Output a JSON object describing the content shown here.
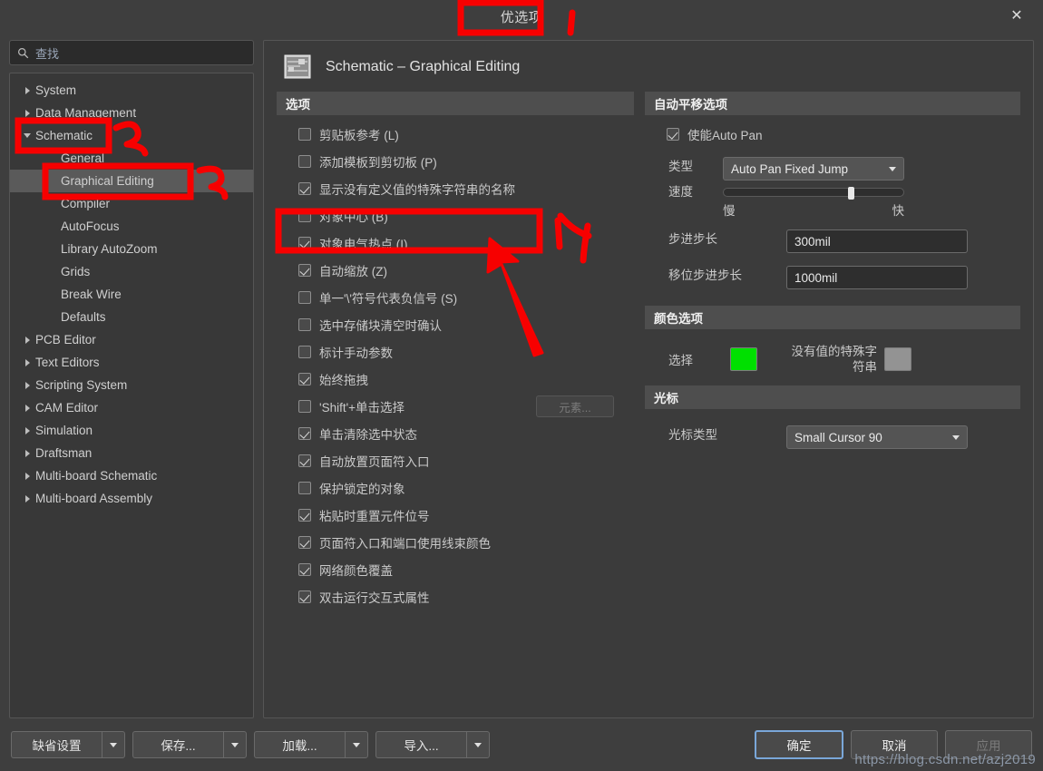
{
  "window": {
    "title": "优选项",
    "close_icon": "close-icon"
  },
  "search": {
    "placeholder": "查找",
    "value": "查找",
    "icon": "search-icon"
  },
  "tree": {
    "items": [
      {
        "label": "System",
        "level": 0,
        "expander": "collapsed",
        "selected": false
      },
      {
        "label": "Data Management",
        "level": 0,
        "expander": "collapsed",
        "selected": false
      },
      {
        "label": "Schematic",
        "level": 0,
        "expander": "expanded",
        "selected": false
      },
      {
        "label": "General",
        "level": 1,
        "expander": "none",
        "selected": false
      },
      {
        "label": "Graphical Editing",
        "level": 1,
        "expander": "none",
        "selected": true
      },
      {
        "label": "Compiler",
        "level": 1,
        "expander": "none",
        "selected": false
      },
      {
        "label": "AutoFocus",
        "level": 1,
        "expander": "none",
        "selected": false
      },
      {
        "label": "Library AutoZoom",
        "level": 1,
        "expander": "none",
        "selected": false
      },
      {
        "label": "Grids",
        "level": 1,
        "expander": "none",
        "selected": false
      },
      {
        "label": "Break Wire",
        "level": 1,
        "expander": "none",
        "selected": false
      },
      {
        "label": "Defaults",
        "level": 1,
        "expander": "none",
        "selected": false
      },
      {
        "label": "PCB Editor",
        "level": 0,
        "expander": "collapsed",
        "selected": false
      },
      {
        "label": "Text Editors",
        "level": 0,
        "expander": "collapsed",
        "selected": false
      },
      {
        "label": "Scripting System",
        "level": 0,
        "expander": "collapsed",
        "selected": false
      },
      {
        "label": "CAM Editor",
        "level": 0,
        "expander": "collapsed",
        "selected": false
      },
      {
        "label": "Simulation",
        "level": 0,
        "expander": "collapsed",
        "selected": false
      },
      {
        "label": "Draftsman",
        "level": 0,
        "expander": "collapsed",
        "selected": false
      },
      {
        "label": "Multi-board Schematic",
        "level": 0,
        "expander": "collapsed",
        "selected": false
      },
      {
        "label": "Multi-board Assembly",
        "level": 0,
        "expander": "collapsed",
        "selected": false
      }
    ]
  },
  "page": {
    "title": "Schematic – Graphical Editing",
    "icon": "schematic-document-icon"
  },
  "options_group": {
    "header": "选项",
    "items": [
      {
        "label": "剪贴板参考 (L)",
        "checked": false
      },
      {
        "label": "添加模板到剪切板 (P)",
        "checked": false
      },
      {
        "label": "显示没有定义值的特殊字符串的名称",
        "checked": true
      },
      {
        "label": "对象中心 (B)",
        "checked": false
      },
      {
        "label": "对象电气热点 (I)",
        "checked": true
      },
      {
        "label": "自动缩放 (Z)",
        "checked": true
      },
      {
        "label": "单一'\\'符号代表负信号 (S)",
        "checked": false
      },
      {
        "label": "选中存储块清空时确认",
        "checked": false
      },
      {
        "label": "标计手动参数",
        "checked": false
      },
      {
        "label": "始终拖拽",
        "checked": true
      },
      {
        "label": "'Shift'+单击选择",
        "checked": false,
        "trailing_button": "元素..."
      },
      {
        "label": "单击清除选中状态",
        "checked": true
      },
      {
        "label": "自动放置页面符入口",
        "checked": true
      },
      {
        "label": "保护锁定的对象",
        "checked": false
      },
      {
        "label": "粘贴时重置元件位号",
        "checked": true
      },
      {
        "label": "页面符入口和端口使用线束颜色",
        "checked": true
      },
      {
        "label": "网络颜色覆盖",
        "checked": true
      },
      {
        "label": "双击运行交互式属性",
        "checked": true
      }
    ]
  },
  "autopan_group": {
    "header": "自动平移选项",
    "enable": {
      "label": "使能Auto Pan",
      "checked": true
    },
    "style_label": "类型",
    "style_value": "Auto Pan Fixed Jump",
    "speed_label": "速度",
    "speed_slow": "慢",
    "speed_fast": "快",
    "speed_percent": 69,
    "step_label": "步进步长",
    "step_value": "300mil",
    "shift_step_label": "移位步进步长",
    "shift_step_value": "1000mil"
  },
  "color_group": {
    "header": "颜色选项",
    "selection_label": "选择",
    "selection_color": "#00e000",
    "novalue_label": "没有值的特殊字符串",
    "novalue_color": "#939393"
  },
  "cursor_group": {
    "header": "光标",
    "type_label": "光标类型",
    "type_value": "Small Cursor 90"
  },
  "footer": {
    "left_buttons": [
      {
        "label": "缺省设置"
      },
      {
        "label": "保存..."
      },
      {
        "label": "加载..."
      },
      {
        "label": "导入..."
      }
    ],
    "ok": "确定",
    "cancel": "取消",
    "apply": "应用",
    "watermark": "https://blog.csdn.net/azj2019"
  },
  "annotations": {
    "color": "#f70000",
    "markers": [
      {
        "id": "1",
        "text": ""
      },
      {
        "id": "2",
        "text": "2"
      },
      {
        "id": "3",
        "text": "3"
      },
      {
        "id": "4",
        "text": "4"
      }
    ]
  }
}
